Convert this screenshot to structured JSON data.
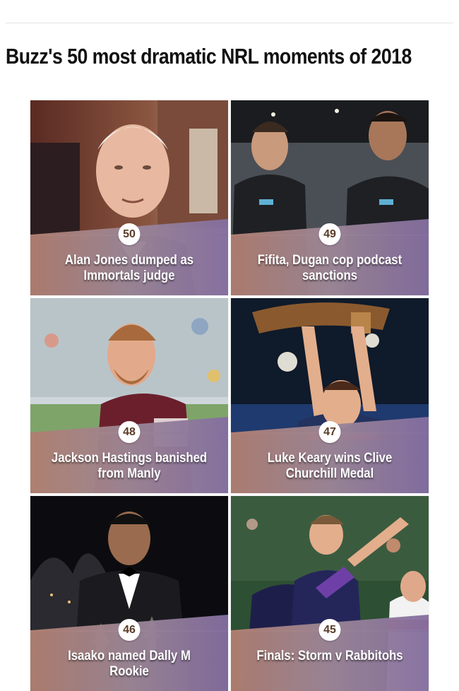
{
  "page": {
    "title": "Buzz's 50 most dramatic NRL moments of 2018"
  },
  "items": [
    {
      "rank": "50",
      "title": "Alan Jones dumped as Immortals judge",
      "image": "alan-jones-photo"
    },
    {
      "rank": "49",
      "title": "Fifita, Dugan cop podcast sanctions",
      "image": "sharks-players-airport-photo"
    },
    {
      "rank": "48",
      "title": "Jackson Hastings banished from Manly",
      "image": "jackson-hastings-manly-photo"
    },
    {
      "rank": "47",
      "title": "Luke Keary wins Clive Churchill Medal",
      "image": "luke-keary-trophy-photo"
    },
    {
      "rank": "46",
      "title": "Isaako named Dally M Rookie",
      "image": "isaako-dally-m-photo"
    },
    {
      "rank": "45",
      "title": "Finals: Storm v Rabbitohs",
      "image": "storm-v-rabbitohs-photo"
    }
  ]
}
